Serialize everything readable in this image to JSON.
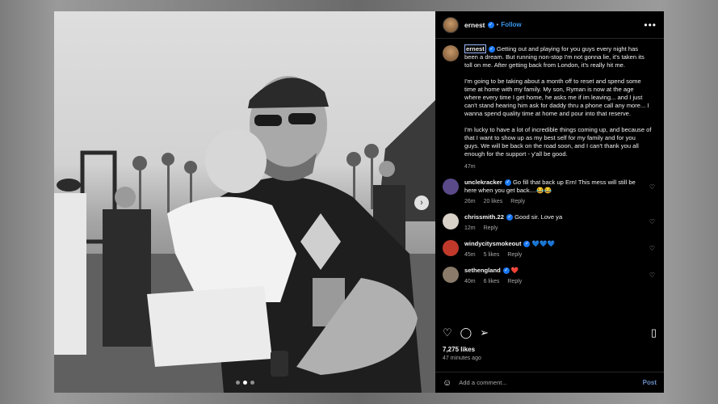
{
  "header": {
    "username": "ernest",
    "separator": "•",
    "follow_label": "Follow",
    "more_label": "•••"
  },
  "caption": {
    "username": "ernest",
    "paragraphs": [
      "Getting out and playing for you guys every night has been a dream. But running non-stop I'm not gonna lie, it's taken its toll on me. After getting back from London, it's really hit me.",
      "I'm going to be taking about a month off to reset and spend some time at home with my family. My son, Ryman is now at the age where every time I get home, he asks me if im leaving... and I just can't stand hearing him ask for daddy thru a phone call any more... I wanna spend quality time at home and pour into that reserve.",
      "I'm lucky to have a lot of incredible things coming up, and because of that I want to show up as my best self for my family and for you guys. We will be back on the road soon, and I can't thank you all enough for the support - y'all be good."
    ],
    "time": "47m"
  },
  "comments": [
    {
      "username": "unclekracker",
      "text": "Go fill that back up Ern! This mess will still be here when you get back....😂😂",
      "time": "26m",
      "likes": "20 likes",
      "reply": "Reply",
      "avatar_color": "#5a4a8a"
    },
    {
      "username": "chrissmith.22",
      "text": "Good sir. Love ya",
      "time": "12m",
      "likes": "",
      "reply": "Reply",
      "avatar_color": "#d8d2c8"
    },
    {
      "username": "windycitysmokeout",
      "text": "💙💙💙",
      "time": "45m",
      "likes": "5 likes",
      "reply": "Reply",
      "avatar_color": "#c0392b"
    },
    {
      "username": "sethengland",
      "text": "❤️",
      "time": "40m",
      "likes": "6 likes",
      "reply": "Reply",
      "avatar_color": "#8a7a6a"
    }
  ],
  "post": {
    "likes": "7,275 likes",
    "time_ago": "47 minutes ago"
  },
  "add_comment": {
    "placeholder": "Add a comment...",
    "post_label": "Post"
  },
  "carousel": {
    "next_label": "›",
    "dot_count": 3,
    "active_dot": 1
  },
  "icons": {
    "verified": "verified-badge-icon",
    "like": "heart-icon",
    "comment": "comment-icon",
    "share": "share-icon",
    "save": "bookmark-icon",
    "emoji": "emoji-icon"
  },
  "colors": {
    "panel_bg": "#000000",
    "link_blue": "#3897f0",
    "verified_blue": "#1877f2",
    "muted_text": "#a8a8a8"
  }
}
